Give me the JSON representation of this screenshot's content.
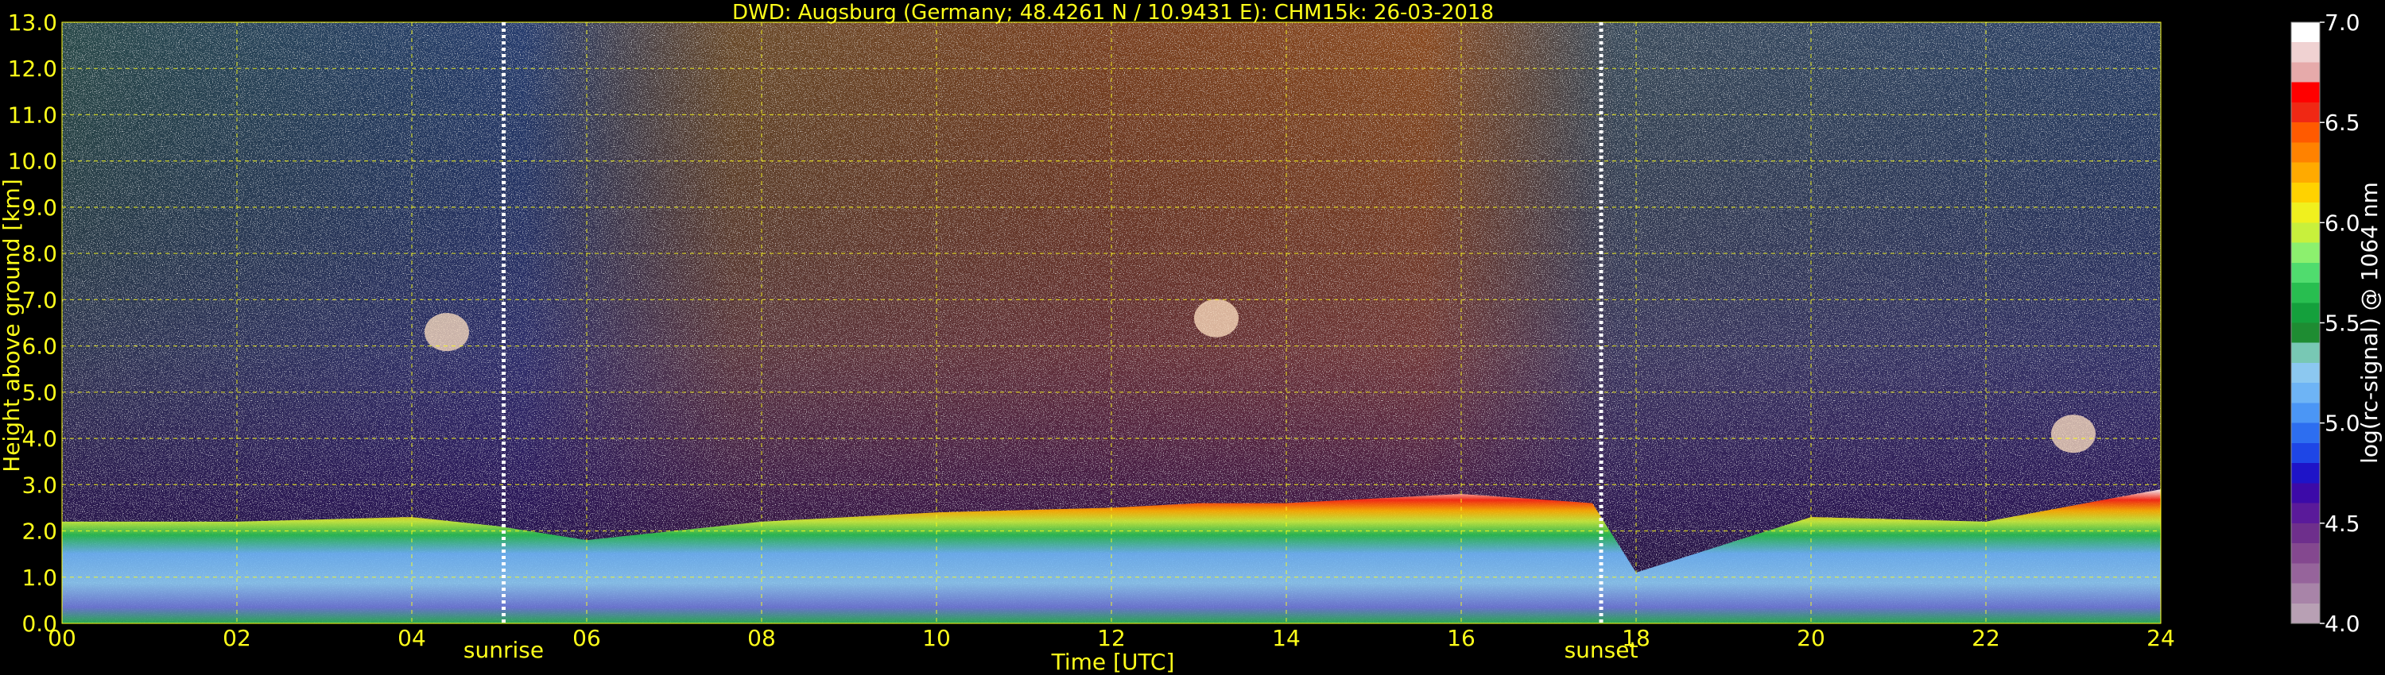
{
  "chart_data": {
    "type": "heatmap",
    "title": "DWD: Augsburg (Germany; 48.4261 N / 10.9431 E):    CHM15k: 26-03-2018",
    "xlabel": "Time [UTC]",
    "ylabel": "Height above ground [km]",
    "xlim": [
      0,
      24
    ],
    "ylim": [
      0,
      13
    ],
    "x_ticks": [
      "00",
      "02",
      "04",
      "06",
      "08",
      "10",
      "12",
      "14",
      "16",
      "18",
      "20",
      "22",
      "24"
    ],
    "y_ticks": [
      "0.0",
      "1.0",
      "2.0",
      "3.0",
      "4.0",
      "5.0",
      "6.0",
      "7.0",
      "8.0",
      "9.0",
      "10.0",
      "11.0",
      "12.0",
      "13.0"
    ],
    "grid": true,
    "annotations": [
      {
        "label": "sunrise",
        "x": 5.05
      },
      {
        "label": "sunset",
        "x": 17.6
      }
    ],
    "colorbar": {
      "label": "log(rc-signal) @ 1064 nm",
      "range": [
        4.0,
        7.0
      ],
      "ticks": [
        "4.0",
        "4.5",
        "5.0",
        "5.5",
        "6.0",
        "6.5",
        "7.0"
      ],
      "colors": [
        "#b8a0b4",
        "#a884a8",
        "#96649b",
        "#84488f",
        "#6e2f8c",
        "#5a1a9a",
        "#3c0aa8",
        "#1e14c8",
        "#1e46e6",
        "#2d6ef0",
        "#4b96f5",
        "#6eb4f5",
        "#8cc8f0",
        "#78c8b4",
        "#1e8c32",
        "#14a03c",
        "#28be50",
        "#50dc6e",
        "#8cf06e",
        "#c8f03c",
        "#f0f01e",
        "#ffd200",
        "#ffaa00",
        "#ff8200",
        "#ff5a00",
        "#f02814",
        "#ff0000",
        "#e6aaaa",
        "#f0d2d2",
        "#ffffff"
      ]
    },
    "layers": [
      {
        "name": "boundary layer",
        "x": [
          0,
          2,
          4,
          5,
          6,
          8,
          10,
          12,
          13,
          14,
          16,
          17.5,
          18,
          20,
          22,
          24
        ],
        "top_km": [
          2.2,
          2.2,
          2.3,
          2.1,
          1.8,
          2.2,
          2.4,
          2.5,
          2.6,
          2.6,
          2.8,
          2.6,
          1.1,
          2.3,
          2.2,
          2.9
        ]
      },
      {
        "name": "cloud patch",
        "x": 4.4,
        "y": 6.3
      },
      {
        "name": "cloud patch",
        "x": 13.2,
        "y": 6.6
      },
      {
        "name": "cloud patch",
        "x": 23.0,
        "y": 4.1
      }
    ]
  }
}
